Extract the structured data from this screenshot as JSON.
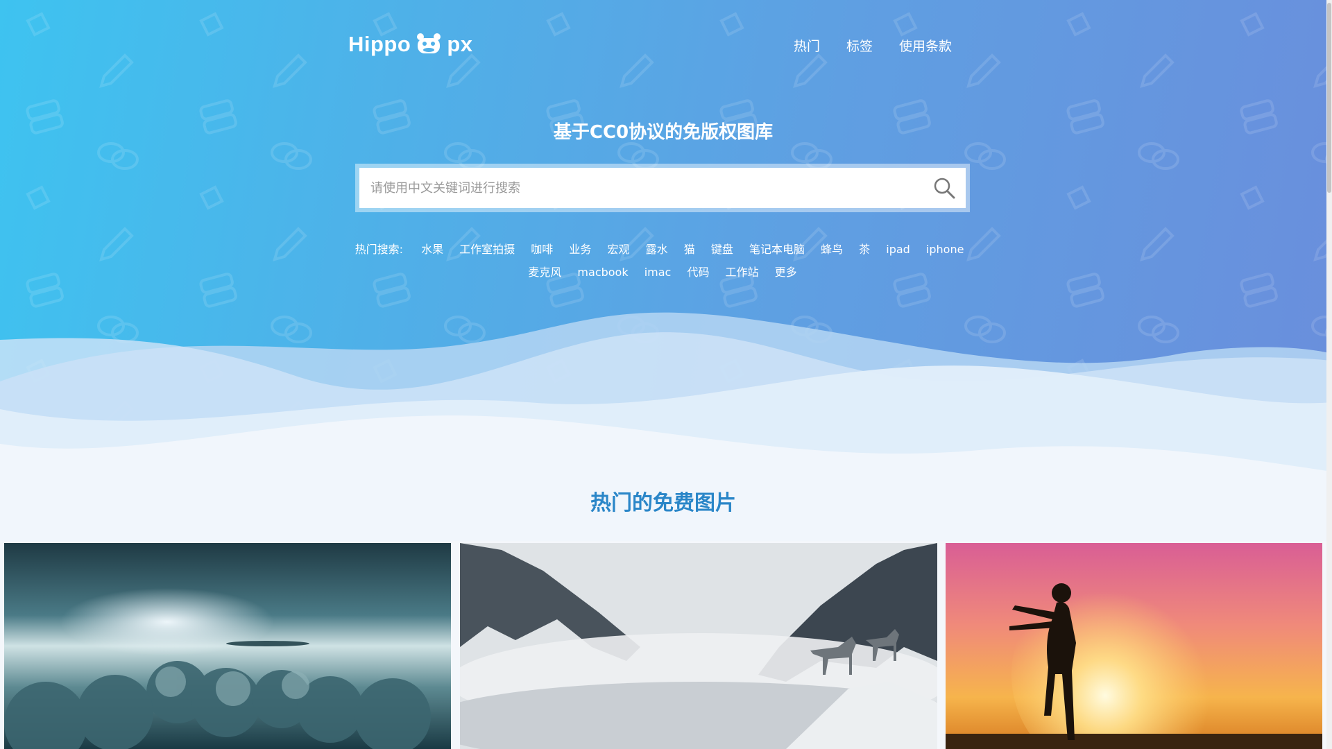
{
  "brand": {
    "logo_left": "Hippo",
    "logo_right": "px"
  },
  "nav": {
    "items": [
      "热门",
      "标签",
      "使用条款"
    ]
  },
  "hero": {
    "tagline": "基于CC0协议的免版权图库"
  },
  "search": {
    "placeholder": "请使用中文关键词进行搜索",
    "value": ""
  },
  "hot_searches": {
    "label": "热门搜索:",
    "tags": [
      "水果",
      "工作室拍摄",
      "咖啡",
      "业务",
      "宏观",
      "露水",
      "猫",
      "键盘",
      "笔记本电脑",
      "蜂鸟",
      "茶",
      "ipad",
      "iphone",
      "麦克风",
      "macbook",
      "imac",
      "代码",
      "工作站",
      "更多"
    ]
  },
  "gallery": {
    "title": "热门的免费图片",
    "photos": [
      {
        "subject": "stormy sky clouds"
      },
      {
        "subject": "wolves in misty forest"
      },
      {
        "subject": "woman silhouette at sunset"
      }
    ]
  },
  "colors": {
    "hero_start": "#3ec3f0",
    "hero_end": "#6a8edc",
    "title_blue": "#2a86c8"
  },
  "icons": {
    "search": "search-icon",
    "logo": "hippo-logo-icon"
  }
}
